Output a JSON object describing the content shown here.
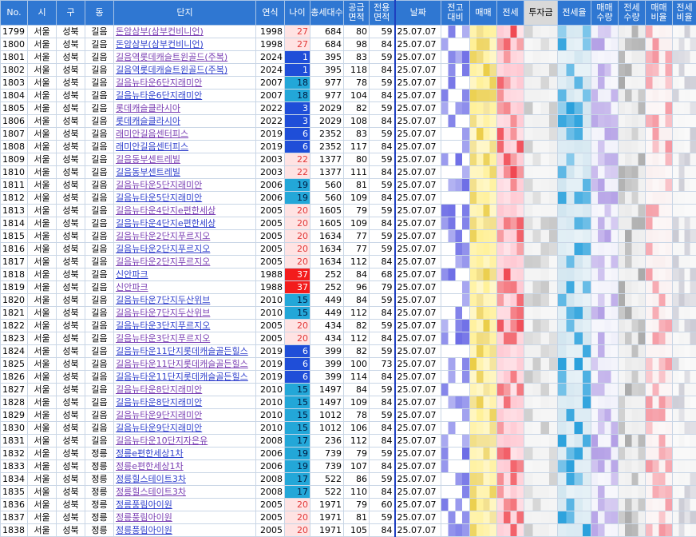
{
  "headers": [
    "No.",
    "시",
    "구",
    "동",
    "단지",
    "연식",
    "나이",
    "총세대수",
    "공급\n면적",
    "전용\n면적",
    "날짜",
    "전고\n대비",
    "매매",
    "전세",
    "투자금",
    "전세율",
    "매매\n수량",
    "전세\n수량",
    "매매\n비율",
    "전세\n비율"
  ],
  "rows": [
    {
      "no": "1799",
      "si": "서울",
      "gu": "성북",
      "dong": "길음",
      "name": "돈암삼부(삼부컨비니언)",
      "year": "1998",
      "age": "27",
      "hh": "684",
      "sup": "80",
      "exc": "59",
      "date": "25.07.07"
    },
    {
      "no": "1800",
      "si": "서울",
      "gu": "성북",
      "dong": "길음",
      "name": "돈암삼부(삼부컨비니언)",
      "year": "1998",
      "age": "27",
      "hh": "684",
      "sup": "98",
      "exc": "84",
      "date": "25.07.07"
    },
    {
      "no": "1801",
      "si": "서울",
      "gu": "성북",
      "dong": "길음",
      "name": "길음역롯데캐슬트윈골드(주복)",
      "year": "2024",
      "age": "1",
      "hh": "395",
      "sup": "83",
      "exc": "59",
      "date": "25.07.07"
    },
    {
      "no": "1802",
      "si": "서울",
      "gu": "성북",
      "dong": "길음",
      "name": "길음역롯데캐슬트윈골드(주복)",
      "year": "2024",
      "age": "1",
      "hh": "395",
      "sup": "118",
      "exc": "84",
      "date": "25.07.07"
    },
    {
      "no": "1803",
      "si": "서울",
      "gu": "성북",
      "dong": "길음",
      "name": "길음뉴타운6단지래미안",
      "year": "2007",
      "age": "18",
      "hh": "977",
      "sup": "78",
      "exc": "59",
      "date": "25.07.07"
    },
    {
      "no": "1804",
      "si": "서울",
      "gu": "성북",
      "dong": "길음",
      "name": "길음뉴타운6단지래미안",
      "year": "2007",
      "age": "18",
      "hh": "977",
      "sup": "104",
      "exc": "84",
      "date": "25.07.07"
    },
    {
      "no": "1805",
      "si": "서울",
      "gu": "성북",
      "dong": "길음",
      "name": "롯데캐슬클라시아",
      "year": "2022",
      "age": "3",
      "hh": "2029",
      "sup": "82",
      "exc": "59",
      "date": "25.07.07"
    },
    {
      "no": "1806",
      "si": "서울",
      "gu": "성북",
      "dong": "길음",
      "name": "롯데캐슬클라시아",
      "year": "2022",
      "age": "3",
      "hh": "2029",
      "sup": "108",
      "exc": "84",
      "date": "25.07.07"
    },
    {
      "no": "1807",
      "si": "서울",
      "gu": "성북",
      "dong": "길음",
      "name": "래미안길음센터피스",
      "year": "2019",
      "age": "6",
      "hh": "2352",
      "sup": "83",
      "exc": "59",
      "date": "25.07.07"
    },
    {
      "no": "1808",
      "si": "서울",
      "gu": "성북",
      "dong": "길음",
      "name": "래미안길음센터피스",
      "year": "2019",
      "age": "6",
      "hh": "2352",
      "sup": "117",
      "exc": "84",
      "date": "25.07.07"
    },
    {
      "no": "1809",
      "si": "서울",
      "gu": "성북",
      "dong": "길음",
      "name": "길음동부센트레빌",
      "year": "2003",
      "age": "22",
      "hh": "1377",
      "sup": "80",
      "exc": "59",
      "date": "25.07.07"
    },
    {
      "no": "1810",
      "si": "서울",
      "gu": "성북",
      "dong": "길음",
      "name": "길음동부센트레빌",
      "year": "2003",
      "age": "22",
      "hh": "1377",
      "sup": "111",
      "exc": "84",
      "date": "25.07.07"
    },
    {
      "no": "1811",
      "si": "서울",
      "gu": "성북",
      "dong": "길음",
      "name": "길음뉴타운5단지래미안",
      "year": "2006",
      "age": "19",
      "hh": "560",
      "sup": "81",
      "exc": "59",
      "date": "25.07.07"
    },
    {
      "no": "1812",
      "si": "서울",
      "gu": "성북",
      "dong": "길음",
      "name": "길음뉴타운5단지래미안",
      "year": "2006",
      "age": "19",
      "hh": "560",
      "sup": "109",
      "exc": "84",
      "date": "25.07.07"
    },
    {
      "no": "1813",
      "si": "서울",
      "gu": "성북",
      "dong": "길음",
      "name": "길음뉴타운4단지e편한세상",
      "year": "2005",
      "age": "20",
      "hh": "1605",
      "sup": "79",
      "exc": "59",
      "date": "25.07.07"
    },
    {
      "no": "1814",
      "si": "서울",
      "gu": "성북",
      "dong": "길음",
      "name": "길음뉴타운4단지e편한세상",
      "year": "2005",
      "age": "20",
      "hh": "1605",
      "sup": "109",
      "exc": "84",
      "date": "25.07.07"
    },
    {
      "no": "1815",
      "si": "서울",
      "gu": "성북",
      "dong": "길음",
      "name": "길음뉴타운2단지푸르지오",
      "year": "2005",
      "age": "20",
      "hh": "1634",
      "sup": "77",
      "exc": "59",
      "date": "25.07.07"
    },
    {
      "no": "1816",
      "si": "서울",
      "gu": "성북",
      "dong": "길음",
      "name": "길음뉴타운2단지푸르지오",
      "year": "2005",
      "age": "20",
      "hh": "1634",
      "sup": "77",
      "exc": "59",
      "date": "25.07.07"
    },
    {
      "no": "1817",
      "si": "서울",
      "gu": "성북",
      "dong": "길음",
      "name": "길음뉴타운2단지푸르지오",
      "year": "2005",
      "age": "20",
      "hh": "1634",
      "sup": "112",
      "exc": "84",
      "date": "25.07.07"
    },
    {
      "no": "1818",
      "si": "서울",
      "gu": "성북",
      "dong": "길음",
      "name": "신안파크",
      "year": "1988",
      "age": "37",
      "hh": "252",
      "sup": "84",
      "exc": "68",
      "date": "25.07.07"
    },
    {
      "no": "1819",
      "si": "서울",
      "gu": "성북",
      "dong": "길음",
      "name": "신안파크",
      "year": "1988",
      "age": "37",
      "hh": "252",
      "sup": "96",
      "exc": "79",
      "date": "25.07.07"
    },
    {
      "no": "1820",
      "si": "서울",
      "gu": "성북",
      "dong": "길음",
      "name": "길음뉴타운7단지두산위브",
      "year": "2010",
      "age": "15",
      "hh": "449",
      "sup": "84",
      "exc": "59",
      "date": "25.07.07"
    },
    {
      "no": "1821",
      "si": "서울",
      "gu": "성북",
      "dong": "길음",
      "name": "길음뉴타운7단지두산위브",
      "year": "2010",
      "age": "15",
      "hh": "449",
      "sup": "112",
      "exc": "84",
      "date": "25.07.07"
    },
    {
      "no": "1822",
      "si": "서울",
      "gu": "성북",
      "dong": "길음",
      "name": "길음뉴타운3단지푸르지오",
      "year": "2005",
      "age": "20",
      "hh": "434",
      "sup": "82",
      "exc": "59",
      "date": "25.07.07"
    },
    {
      "no": "1823",
      "si": "서울",
      "gu": "성북",
      "dong": "길음",
      "name": "길음뉴타운3단지푸르지오",
      "year": "2005",
      "age": "20",
      "hh": "434",
      "sup": "112",
      "exc": "84",
      "date": "25.07.07"
    },
    {
      "no": "1824",
      "si": "서울",
      "gu": "성북",
      "dong": "길음",
      "name": "길음뉴타운11단지롯데캐슬골든힐스",
      "year": "2019",
      "age": "6",
      "hh": "399",
      "sup": "82",
      "exc": "59",
      "date": "25.07.07"
    },
    {
      "no": "1825",
      "si": "서울",
      "gu": "성북",
      "dong": "길음",
      "name": "길음뉴타운11단지롯데캐슬골든힐스",
      "year": "2019",
      "age": "6",
      "hh": "399",
      "sup": "100",
      "exc": "73",
      "date": "25.07.07"
    },
    {
      "no": "1826",
      "si": "서울",
      "gu": "성북",
      "dong": "길음",
      "name": "길음뉴타운11단지롯데캐슬골든힐스",
      "year": "2019",
      "age": "6",
      "hh": "399",
      "sup": "114",
      "exc": "84",
      "date": "25.07.07"
    },
    {
      "no": "1827",
      "si": "서울",
      "gu": "성북",
      "dong": "길음",
      "name": "길음뉴타운8단지래미안",
      "year": "2010",
      "age": "15",
      "hh": "1497",
      "sup": "84",
      "exc": "59",
      "date": "25.07.07"
    },
    {
      "no": "1828",
      "si": "서울",
      "gu": "성북",
      "dong": "길음",
      "name": "길음뉴타운8단지래미안",
      "year": "2010",
      "age": "15",
      "hh": "1497",
      "sup": "109",
      "exc": "84",
      "date": "25.07.07"
    },
    {
      "no": "1829",
      "si": "서울",
      "gu": "성북",
      "dong": "길음",
      "name": "길음뉴타운9단지래미안",
      "year": "2010",
      "age": "15",
      "hh": "1012",
      "sup": "78",
      "exc": "59",
      "date": "25.07.07"
    },
    {
      "no": "1830",
      "si": "서울",
      "gu": "성북",
      "dong": "길음",
      "name": "길음뉴타운9단지래미안",
      "year": "2010",
      "age": "15",
      "hh": "1012",
      "sup": "106",
      "exc": "84",
      "date": "25.07.07"
    },
    {
      "no": "1831",
      "si": "서울",
      "gu": "성북",
      "dong": "길음",
      "name": "길음뉴타운10단지자은유",
      "year": "2008",
      "age": "17",
      "hh": "236",
      "sup": "112",
      "exc": "84",
      "date": "25.07.07"
    },
    {
      "no": "1832",
      "si": "서울",
      "gu": "성북",
      "dong": "정릉",
      "name": "정릉e편한세상1차",
      "year": "2006",
      "age": "19",
      "hh": "739",
      "sup": "79",
      "exc": "59",
      "date": "25.07.07"
    },
    {
      "no": "1833",
      "si": "서울",
      "gu": "성북",
      "dong": "정릉",
      "name": "정릉e편한세상1차",
      "year": "2006",
      "age": "19",
      "hh": "739",
      "sup": "107",
      "exc": "84",
      "date": "25.07.07"
    },
    {
      "no": "1834",
      "si": "서울",
      "gu": "성북",
      "dong": "정릉",
      "name": "정릉힐스테이트3차",
      "year": "2008",
      "age": "17",
      "hh": "522",
      "sup": "86",
      "exc": "59",
      "date": "25.07.07"
    },
    {
      "no": "1835",
      "si": "서울",
      "gu": "성북",
      "dong": "정릉",
      "name": "정릉힐스테이트3차",
      "year": "2008",
      "age": "17",
      "hh": "522",
      "sup": "110",
      "exc": "84",
      "date": "25.07.07"
    },
    {
      "no": "1836",
      "si": "서울",
      "gu": "성북",
      "dong": "정릉",
      "name": "정릉풍림아이원",
      "year": "2005",
      "age": "20",
      "hh": "1971",
      "sup": "79",
      "exc": "60",
      "date": "25.07.07"
    },
    {
      "no": "1837",
      "si": "서울",
      "gu": "성북",
      "dong": "정릉",
      "name": "정릉풍림아이원",
      "year": "2005",
      "age": "20",
      "hh": "1971",
      "sup": "81",
      "exc": "59",
      "date": "25.07.07"
    },
    {
      "no": "1838",
      "si": "서울",
      "gu": "성북",
      "dong": "정릉",
      "name": "정릉풍림아이원",
      "year": "2005",
      "age": "20",
      "hh": "1971",
      "sup": "105",
      "exc": "84",
      "date": "25.07.07"
    }
  ]
}
